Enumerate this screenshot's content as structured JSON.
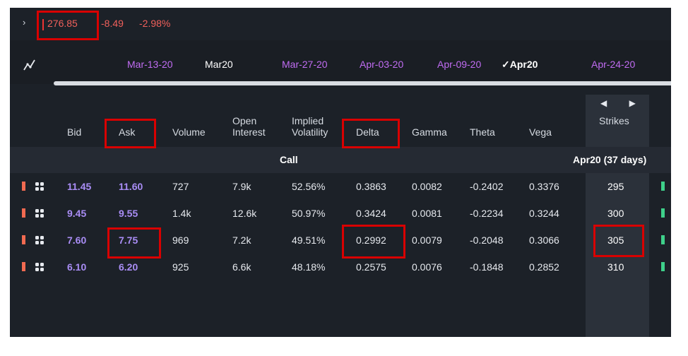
{
  "quote": {
    "caret": "›",
    "price": "276.85",
    "change": "-8.49",
    "change_pct": "-2.98%"
  },
  "expirations": [
    {
      "label": "Mar-13-20",
      "selected": false
    },
    {
      "label": "Mar20",
      "selected": false
    },
    {
      "label": "Mar-27-20",
      "selected": false
    },
    {
      "label": "Apr-03-20",
      "selected": false
    },
    {
      "label": "Apr-09-20",
      "selected": false
    },
    {
      "label": "✓Apr20",
      "selected": true
    },
    {
      "label": "Apr-24-20",
      "selected": false
    }
  ],
  "columns": {
    "bid": "Bid",
    "ask": "Ask",
    "volume": "Volume",
    "open_interest_1": "Open",
    "open_interest_2": "Interest",
    "iv_1": "Implied",
    "iv_2": "Volatility",
    "delta": "Delta",
    "gamma": "Gamma",
    "theta": "Theta",
    "vega": "Vega",
    "strikes": "Strikes",
    "strike_nav": "◀ ▶"
  },
  "section": {
    "call_label": "Call",
    "expiry_days": "Apr20 (37 days)"
  },
  "rows": [
    {
      "bid": "11.45",
      "ask": "11.60",
      "volume": "727",
      "open_interest": "7.9k",
      "iv": "52.56%",
      "delta": "0.3863",
      "gamma": "0.0082",
      "theta": "-0.2402",
      "vega": "0.3376",
      "strike": "295"
    },
    {
      "bid": "9.45",
      "ask": "9.55",
      "volume": "1.4k",
      "open_interest": "12.6k",
      "iv": "50.97%",
      "delta": "0.3424",
      "gamma": "0.0081",
      "theta": "-0.2234",
      "vega": "0.3244",
      "strike": "300"
    },
    {
      "bid": "7.60",
      "ask": "7.75",
      "volume": "969",
      "open_interest": "7.2k",
      "iv": "49.51%",
      "delta": "0.2992",
      "gamma": "0.0079",
      "theta": "-0.2048",
      "vega": "0.3066",
      "strike": "305"
    },
    {
      "bid": "6.10",
      "ask": "6.20",
      "volume": "925",
      "open_interest": "6.6k",
      "iv": "48.18%",
      "delta": "0.2575",
      "gamma": "0.0076",
      "theta": "-0.1848",
      "vega": "0.2852",
      "strike": "310"
    }
  ],
  "colors": {
    "accent_purple": "#c06cf2",
    "price_red": "#f0605b",
    "highlight_red": "#d90000",
    "bid_ask": "#a98df5"
  },
  "icons": [
    "chevron-right-icon",
    "chart-line-icon",
    "checkmark-icon",
    "arrow-left-icon",
    "arrow-right-icon",
    "grid-dots-icon"
  ]
}
